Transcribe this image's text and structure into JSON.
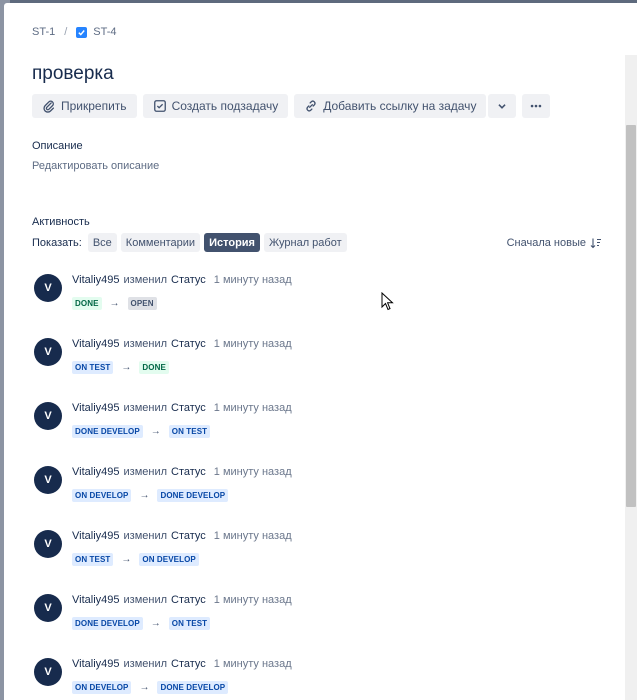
{
  "breadcrumb": {
    "parent": "ST-1",
    "separator": "/",
    "current": "ST-4"
  },
  "issue": {
    "title": "проверка"
  },
  "toolbar": {
    "attach_label": "Прикрепить",
    "subtask_label": "Создать подзадачу",
    "link_label": "Добавить ссылку на задачу"
  },
  "description": {
    "label": "Описание",
    "edit": "Редактировать описание"
  },
  "activity": {
    "label": "Активность",
    "show_label": "Показать:",
    "filters": [
      "Все",
      "Комментарии",
      "История",
      "Журнал работ"
    ],
    "active_filter": "История",
    "sort_label": "Сначала новые"
  },
  "history": [
    {
      "avatar": "V",
      "user": "Vitaliy495",
      "verb": "изменил",
      "field": "Статус",
      "time": "1 минуту назад",
      "from": "DONE",
      "to": "OPEN",
      "from_color": "green",
      "to_color": "grey"
    },
    {
      "avatar": "V",
      "user": "Vitaliy495",
      "verb": "изменил",
      "field": "Статус",
      "time": "1 минуту назад",
      "from": "ON TEST",
      "to": "DONE",
      "from_color": "blue",
      "to_color": "green"
    },
    {
      "avatar": "V",
      "user": "Vitaliy495",
      "verb": "изменил",
      "field": "Статус",
      "time": "1 минуту назад",
      "from": "DONE DEVELOP",
      "to": "ON TEST",
      "from_color": "blue",
      "to_color": "blue"
    },
    {
      "avatar": "V",
      "user": "Vitaliy495",
      "verb": "изменил",
      "field": "Статус",
      "time": "1 минуту назад",
      "from": "ON DEVELOP",
      "to": "DONE DEVELOP",
      "from_color": "blue",
      "to_color": "blue"
    },
    {
      "avatar": "V",
      "user": "Vitaliy495",
      "verb": "изменил",
      "field": "Статус",
      "time": "1 минуту назад",
      "from": "ON TEST",
      "to": "ON DEVELOP",
      "from_color": "blue",
      "to_color": "blue"
    },
    {
      "avatar": "V",
      "user": "Vitaliy495",
      "verb": "изменил",
      "field": "Статус",
      "time": "1 минуту назад",
      "from": "DONE DEVELOP",
      "to": "ON TEST",
      "from_color": "blue",
      "to_color": "blue"
    },
    {
      "avatar": "V",
      "user": "Vitaliy495",
      "verb": "изменил",
      "field": "Статус",
      "time": "1 минуту назад",
      "from": "ON DEVELOP",
      "to": "DONE DEVELOP",
      "from_color": "blue",
      "to_color": "blue"
    }
  ],
  "arrow_glyph": "→",
  "colors": {
    "accent": "#2684ff",
    "active_filter": "#42526e",
    "avatar": "#172b4d"
  }
}
